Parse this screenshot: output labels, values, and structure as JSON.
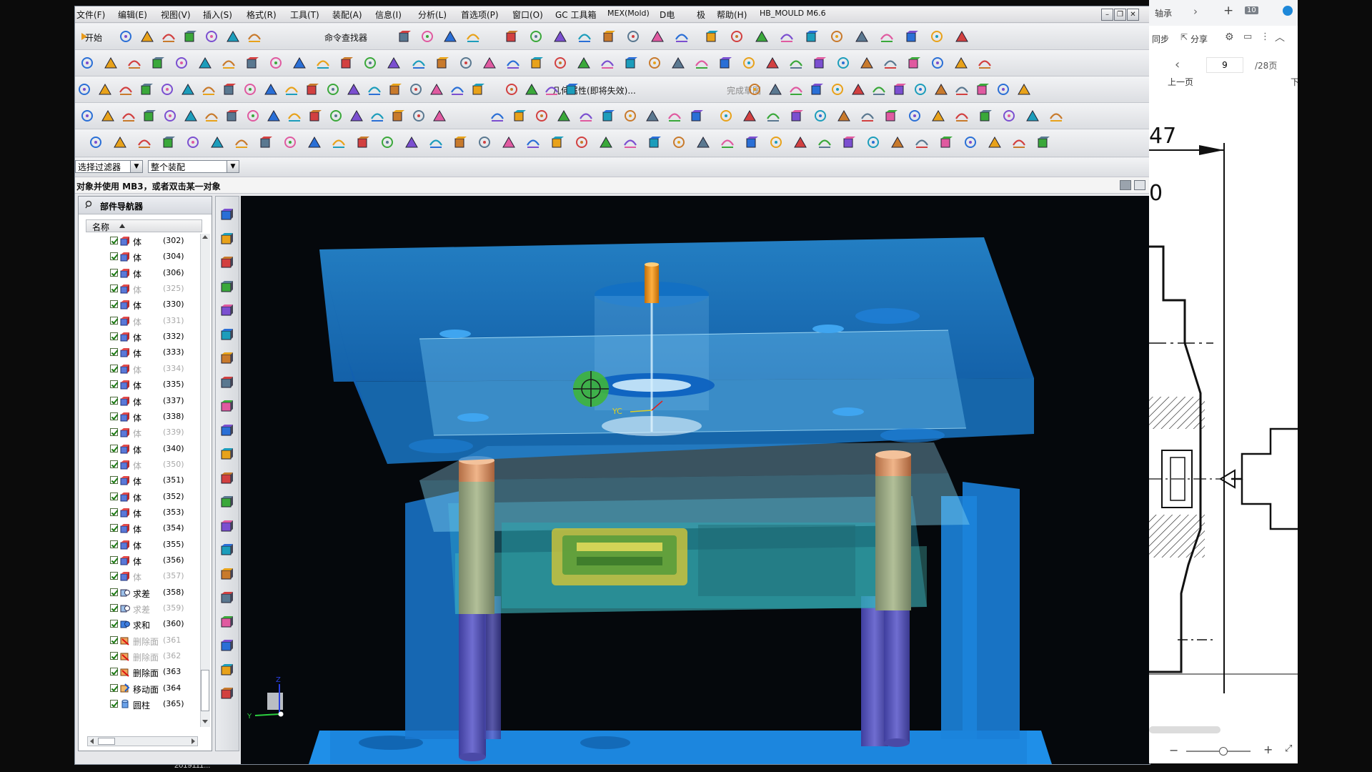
{
  "menu": [
    "文件(F)",
    "编辑(E)",
    "视图(V)",
    "插入(S)",
    "格式(R)",
    "工具(T)",
    "装配(A)",
    "信息(I)",
    "分析(L)",
    "首选项(P)",
    "窗口(O)",
    "GC 工具箱",
    "MEX(Mold)",
    "D电",
    "极",
    "帮助(H)",
    "HB_MOULD M6.6"
  ],
  "toolbar": {
    "start_label": "开始",
    "command_finder": "命令查找器",
    "geom_property": "几何属性(即将失效)...",
    "finish_sketch": "完成草图"
  },
  "selection": {
    "filter": "选择过滤器",
    "scope": "整个装配"
  },
  "cue": "对象并使用 MB3，或者双击某一对象",
  "navigator": {
    "title": "部件导航器",
    "column": "名称",
    "items": [
      {
        "name": "体",
        "id": "(302)",
        "icon": "body-icon",
        "dim": false
      },
      {
        "name": "体",
        "id": "(304)",
        "icon": "body-icon",
        "dim": false
      },
      {
        "name": "体",
        "id": "(306)",
        "icon": "body-icon",
        "dim": false
      },
      {
        "name": "体",
        "id": "(325)",
        "icon": "body-icon",
        "dim": true
      },
      {
        "name": "体",
        "id": "(330)",
        "icon": "body-icon",
        "dim": false
      },
      {
        "name": "体",
        "id": "(331)",
        "icon": "body-icon",
        "dim": true
      },
      {
        "name": "体",
        "id": "(332)",
        "icon": "body-icon",
        "dim": false
      },
      {
        "name": "体",
        "id": "(333)",
        "icon": "body-icon",
        "dim": false
      },
      {
        "name": "体",
        "id": "(334)",
        "icon": "body-icon",
        "dim": true
      },
      {
        "name": "体",
        "id": "(335)",
        "icon": "body-icon",
        "dim": false
      },
      {
        "name": "体",
        "id": "(337)",
        "icon": "body-icon",
        "dim": false
      },
      {
        "name": "体",
        "id": "(338)",
        "icon": "body-icon",
        "dim": false
      },
      {
        "name": "体",
        "id": "(339)",
        "icon": "body-icon",
        "dim": true
      },
      {
        "name": "体",
        "id": "(340)",
        "icon": "body-icon",
        "dim": false
      },
      {
        "name": "体",
        "id": "(350)",
        "icon": "body-icon",
        "dim": true
      },
      {
        "name": "体",
        "id": "(351)",
        "icon": "body-icon",
        "dim": false
      },
      {
        "name": "体",
        "id": "(352)",
        "icon": "body-icon",
        "dim": false
      },
      {
        "name": "体",
        "id": "(353)",
        "icon": "body-icon",
        "dim": false
      },
      {
        "name": "体",
        "id": "(354)",
        "icon": "body-icon",
        "dim": false
      },
      {
        "name": "体",
        "id": "(355)",
        "icon": "body-icon",
        "dim": false
      },
      {
        "name": "体",
        "id": "(356)",
        "icon": "body-icon",
        "dim": false
      },
      {
        "name": "体",
        "id": "(357)",
        "icon": "body-icon",
        "dim": true
      },
      {
        "name": "求差",
        "id": "(358)",
        "icon": "subtract-icon",
        "dim": false
      },
      {
        "name": "求差",
        "id": "(359)",
        "icon": "subtract-icon",
        "dim": true
      },
      {
        "name": "求和",
        "id": "(360)",
        "icon": "unite-icon",
        "dim": false
      },
      {
        "name": "删除面",
        "id": "(361",
        "icon": "delete-face-icon",
        "dim": true
      },
      {
        "name": "删除面",
        "id": "(362",
        "icon": "delete-face-icon",
        "dim": true
      },
      {
        "name": "删除面",
        "id": "(363",
        "icon": "delete-face-icon",
        "dim": false
      },
      {
        "name": "移动面",
        "id": "(364",
        "icon": "move-face-icon",
        "dim": false
      },
      {
        "name": "圆柱",
        "id": "(365)",
        "icon": "cylinder-icon",
        "dim": false
      }
    ]
  },
  "viewport": {
    "triad_z": "Z",
    "triad_y": "Y",
    "feature_label": "YC"
  },
  "doc_viewer": {
    "tab_label": "轴承",
    "sync": "同步",
    "share": "分享",
    "page_current": "9",
    "page_total": "/28页",
    "prev_page": "上一页",
    "page_count_badge": "10",
    "dim_47": "47",
    "dim_0": "0",
    "next_initial": "下"
  },
  "taskbar": {
    "text": "2019111..."
  },
  "colors": {
    "mold_blue": "#1f8fe8",
    "ejector": "#5554b8",
    "guide_pin": "#8a9a7a",
    "bushing": "#d4926a",
    "sprue": "#f0941a",
    "cursor_ring": "#3fb43c"
  }
}
